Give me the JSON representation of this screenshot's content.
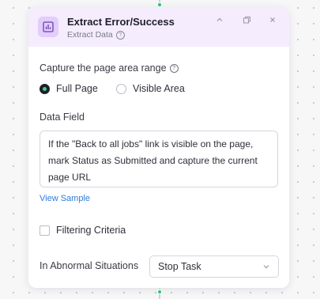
{
  "step": {
    "title": "Extract Error/Success",
    "subtitle": "Extract Data",
    "icon": "bar-chart-icon",
    "accent_color": "#e3cdfa",
    "header_color": "#f5ecfd"
  },
  "capture": {
    "label": "Capture the page area range",
    "options": [
      {
        "label": "Full Page",
        "checked": true
      },
      {
        "label": "Visible Area",
        "checked": false
      }
    ]
  },
  "data_field": {
    "label": "Data Field",
    "value": "If the \"Back to all jobs\" link is visible on the page, mark Status as Submitted and capture the current page URL",
    "view_sample_label": "View Sample"
  },
  "filtering": {
    "label": "Filtering Criteria",
    "checked": false
  },
  "abnormal": {
    "label": "In Abnormal Situations",
    "selected": "Stop Task"
  },
  "colors": {
    "radio_dot": "#3fd08a",
    "link": "#2d7bdc",
    "connector": "#28c76f"
  }
}
